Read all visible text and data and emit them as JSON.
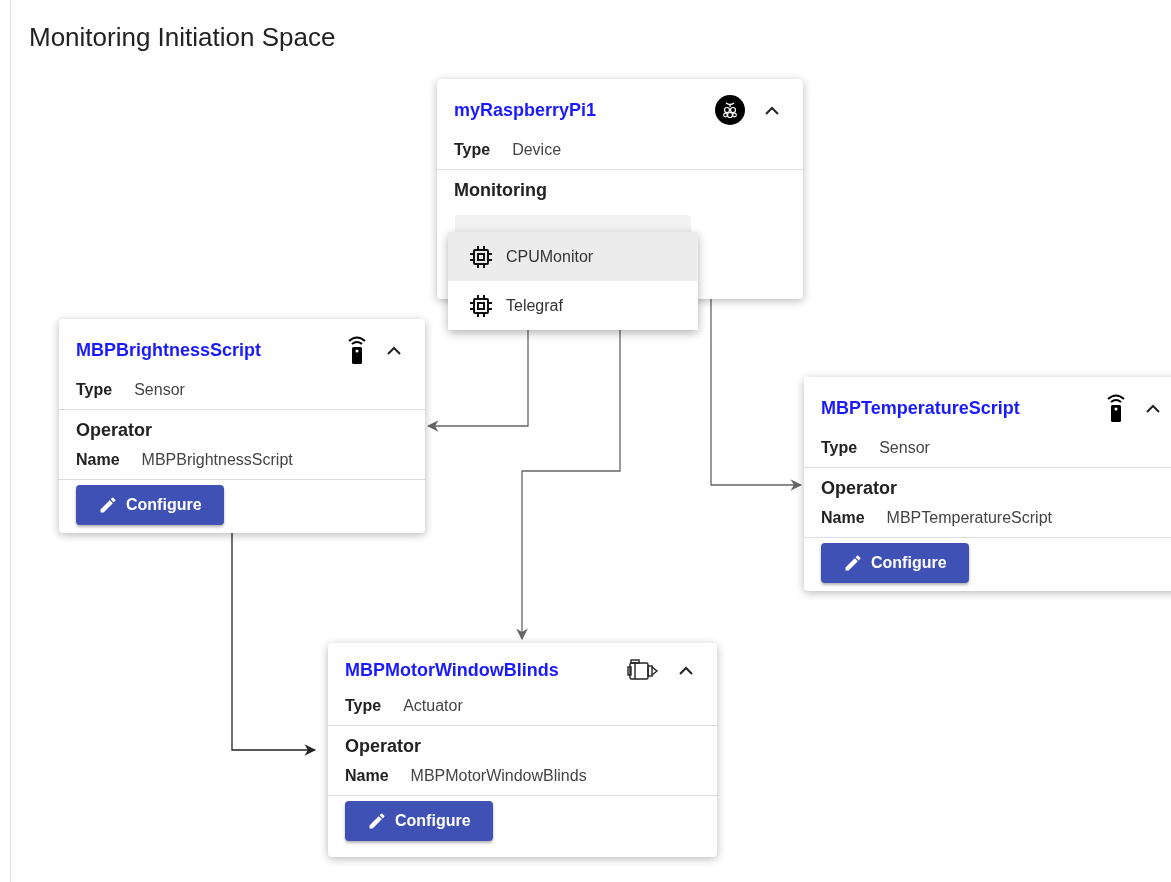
{
  "title": "Monitoring Initiation Space",
  "nodes": [
    {
      "kind": "device",
      "name": "myRaspberryPi1",
      "expanded": true,
      "type_label": "Type",
      "type_value": "Device",
      "section": "Monitoring",
      "menu": [
        {
          "label": "CPUMonitor",
          "selected": true
        },
        {
          "label": "Telegraf",
          "selected": false
        }
      ]
    },
    {
      "kind": "sensor",
      "name": "MBPBrightnessScript",
      "expanded": true,
      "type_label": "Type",
      "type_value": "Sensor",
      "section": "Operator",
      "field_label": "Name",
      "field_value": "MBPBrightnessScript",
      "button": "Configure"
    },
    {
      "kind": "sensor",
      "name": "MBPTemperatureScript",
      "expanded": true,
      "type_label": "Type",
      "type_value": "Sensor",
      "section": "Operator",
      "field_label": "Name",
      "field_value": "MBPTemperatureScript",
      "button": "Configure"
    },
    {
      "kind": "actuator",
      "name": "MBPMotorWindowBlinds",
      "expanded": true,
      "type_label": "Type",
      "type_value": "Actuator",
      "section": "Operator",
      "field_label": "Name",
      "field_value": "MBPMotorWindowBlinds",
      "button": "Configure"
    }
  ]
}
